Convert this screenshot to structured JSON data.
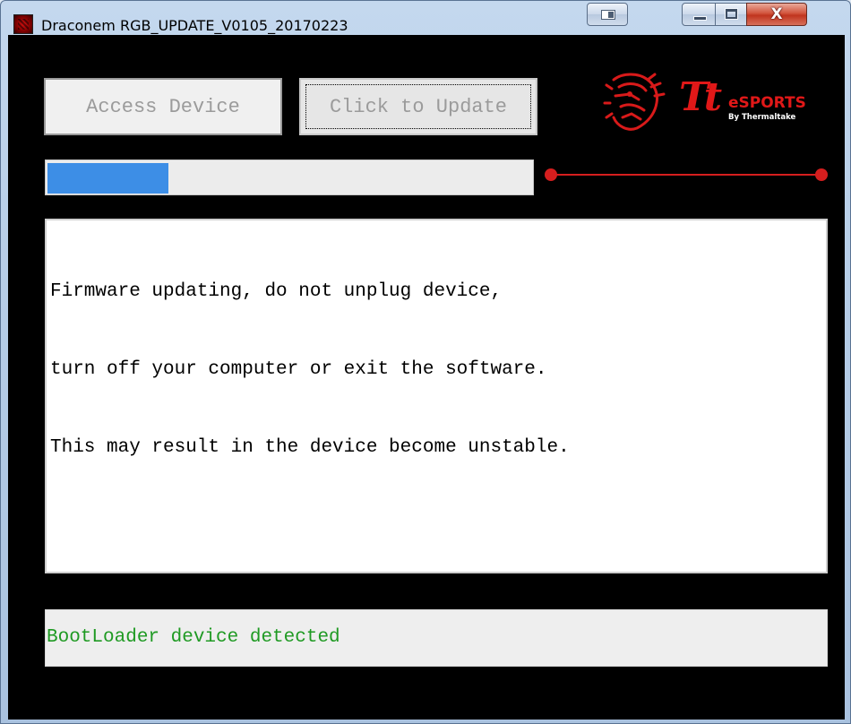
{
  "window": {
    "title": "Draconem RGB_UPDATE_V0105_20170223",
    "controls": {
      "switch_icon": "window-switch-icon",
      "minimize_icon": "minimize-icon",
      "maximize_icon": "maximize-icon",
      "close_glyph": "X"
    }
  },
  "toolbar": {
    "access_label": "Access Device",
    "update_label": "Click to Update"
  },
  "logo": {
    "tt": "Tt",
    "esports": "eSPORTS",
    "by": "By Thermaltake",
    "brand_color": "#e11818"
  },
  "progress": {
    "value_fraction": 0.25,
    "fill_color": "#3d8ee6"
  },
  "log": {
    "lines": [
      "Firmware updating, do not unplug device,",
      "turn off your computer or exit the software.",
      "This may result in the device become unstable."
    ]
  },
  "status": {
    "text": "BootLoader device detected",
    "color": "#1f9a23"
  }
}
